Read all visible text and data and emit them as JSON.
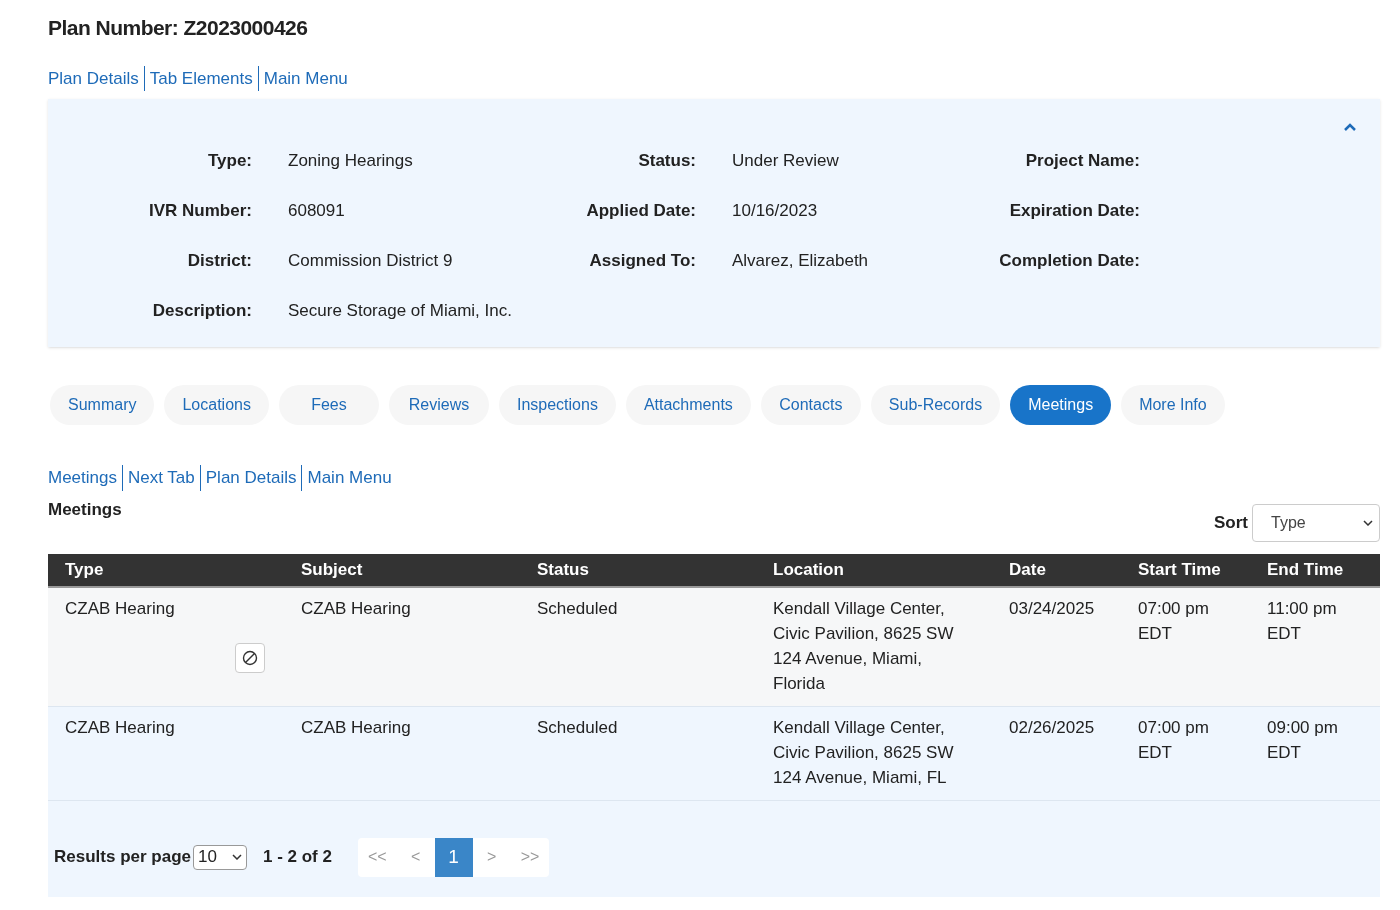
{
  "title": "Plan Number: Z2023000426",
  "top_links": [
    "Plan Details",
    "Tab Elements",
    "Main Menu"
  ],
  "summary": {
    "expanded": true,
    "rows": [
      [
        {
          "label": "Type:",
          "value": "Zoning Hearings"
        },
        {
          "label": "Status:",
          "value": "Under Review"
        },
        {
          "label": "Project Name:"
        }
      ],
      [
        {
          "label": "IVR Number:",
          "value": "608091"
        },
        {
          "label": "Applied Date:",
          "value": "10/16/2023"
        },
        {
          "label": "Expiration Date:"
        }
      ],
      [
        {
          "label": "District:",
          "value": "Commission District 9"
        },
        {
          "label": "Assigned To:",
          "value": "Alvarez, Elizabeth"
        },
        {
          "label": "Completion Date:"
        }
      ],
      [
        {
          "label": "Description:",
          "value": "Secure Storage of Miami, Inc."
        }
      ]
    ]
  },
  "tabs": [
    {
      "label": "Summary",
      "selected": false
    },
    {
      "label": "Locations",
      "selected": false
    },
    {
      "label": "Fees",
      "selected": false
    },
    {
      "label": "Reviews",
      "selected": false
    },
    {
      "label": "Inspections",
      "selected": false
    },
    {
      "label": "Attachments",
      "selected": false
    },
    {
      "label": "Contacts",
      "selected": false
    },
    {
      "label": "Sub-Records",
      "selected": false
    },
    {
      "label": "Meetings",
      "selected": true
    },
    {
      "label": "More Info",
      "selected": false
    }
  ],
  "section_links": [
    "Meetings",
    "Next Tab",
    "Plan Details",
    "Main Menu"
  ],
  "section_title": "Meetings",
  "sort": {
    "label": "Sort",
    "value": "Type"
  },
  "table": {
    "columns": [
      "Type",
      "Subject",
      "Status",
      "Location",
      "Date",
      "Start Time",
      "End Time"
    ],
    "rows": [
      {
        "cells": [
          "CZAB Hearing",
          "CZAB Hearing",
          "Scheduled",
          "Kendall Village Center, Civic Pavilion, 8625 SW 124 Avenue, Miami, Florida",
          "03/24/2025",
          "07:00 pm EDT",
          "11:00 pm EDT"
        ],
        "cancel_button": true
      },
      {
        "cells": [
          "CZAB Hearing",
          "CZAB Hearing",
          "Scheduled",
          "Kendall Village Center, Civic Pavilion, 8625 SW 124 Avenue, Miami, FL",
          "02/26/2025",
          "07:00 pm EDT",
          "09:00 pm EDT"
        ],
        "cancel_button": false
      }
    ]
  },
  "pagination": {
    "per_page_label": "Results per page",
    "per_page": "10",
    "range": "1 - 2 of 2",
    "buttons": [
      {
        "label": "<<",
        "selected": false
      },
      {
        "label": "<",
        "selected": false
      },
      {
        "label": "1",
        "selected": true
      },
      {
        "label": ">",
        "selected": false
      },
      {
        "label": ">>",
        "selected": false
      }
    ]
  }
}
